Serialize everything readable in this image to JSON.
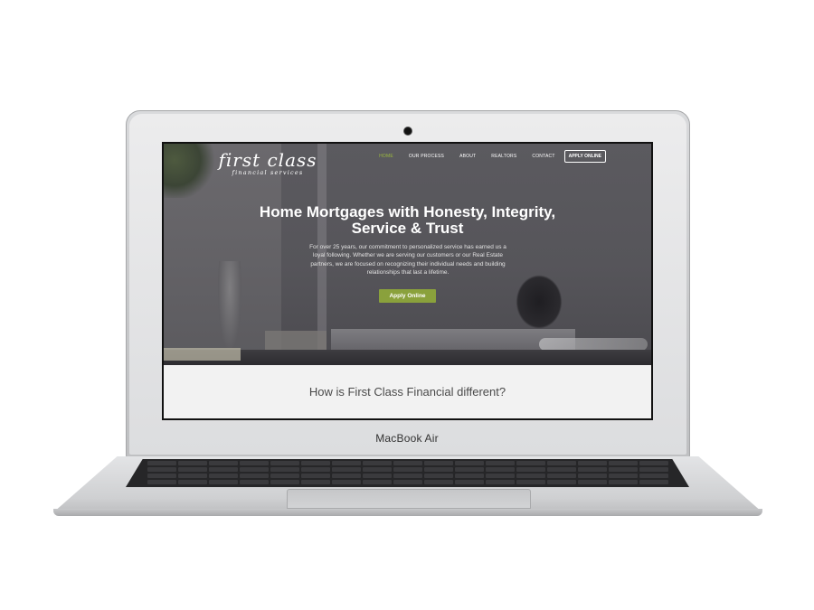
{
  "device": {
    "brand_label": "MacBook Air"
  },
  "site": {
    "logo": {
      "main": "first class",
      "sub": "financial services"
    },
    "nav": {
      "items": [
        {
          "label": "HOME",
          "active": true
        },
        {
          "label": "OUR PROCESS",
          "active": false
        },
        {
          "label": "ABOUT",
          "active": false
        },
        {
          "label": "REALTORS",
          "active": false
        },
        {
          "label": "CONTACT",
          "active": false
        }
      ],
      "cta_label": "APPLY ONLINE"
    },
    "hero": {
      "title_line1": "Home Mortgages with Honesty, Integrity,",
      "title_line2": "Service & Trust",
      "text": "For over 25 years, our commitment to personalized service has earned us a loyal following. Whether we are serving our customers or our Real Estate partners, we are focused on recognizing their individual needs and building relationships that last a lifetime.",
      "button_label": "Apply Online"
    },
    "section": {
      "heading": "How is First Class Financial different?"
    },
    "colors": {
      "accent_green": "#8aa13c",
      "nav_active": "#9cba3f",
      "section_bg": "#f2f2f2"
    }
  }
}
